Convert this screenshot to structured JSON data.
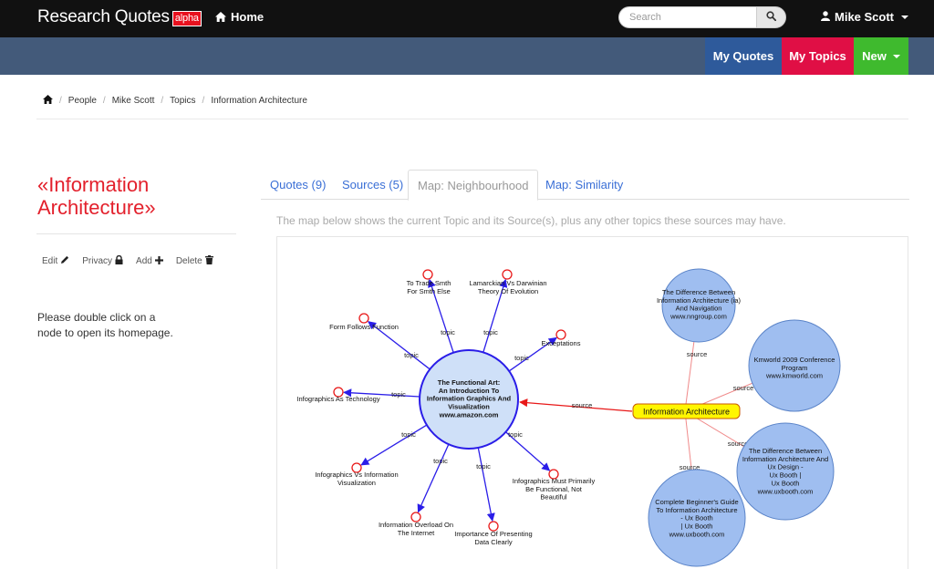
{
  "navbar": {
    "brand": "Research Quotes",
    "brand_badge": "alpha",
    "home_label": "Home",
    "search_placeholder": "Search",
    "user_name": "Mike Scott"
  },
  "subnav": {
    "my_quotes": "My Quotes",
    "my_topics": "My Topics",
    "new_label": "New"
  },
  "colors": {
    "my_quotes": "#2e5a9b",
    "my_topics": "#e00f45",
    "new": "#3fba2e",
    "title_red": "#e3202c",
    "link_blue": "#3a6fd6",
    "node_blue": "#9fbef0"
  },
  "breadcrumb": [
    "People",
    "Mike Scott",
    "Topics",
    "Information Architecture"
  ],
  "topic": {
    "title_line1": "«Information",
    "title_line2": "Architecture»"
  },
  "actions": {
    "edit": "Edit",
    "privacy": "Privacy",
    "add": "Add",
    "delete": "Delete"
  },
  "hint": "Please double click on a node to open its homepage.",
  "tabs": [
    "Quotes (9)",
    "Sources (5)",
    "Map: Neighbourhood",
    "Map: Similarity"
  ],
  "map_description": "The map below shows the current Topic and its Source(s), plus any other topics these sources may have.",
  "map": {
    "center_topic": "Information Architecture",
    "source_book": [
      "The Functional Art:",
      "An Introduction To",
      "Information Graphics And",
      "Visualization",
      "www.amazon.com"
    ],
    "topic_nodes": [
      [
        "To Trade Smth",
        "For Smth Else"
      ],
      [
        "Lamarckian Vs Darwinian",
        "Theory Of Evolution"
      ],
      [
        "Form Follows Function"
      ],
      [
        "Exceptations"
      ],
      [
        "Infographics As Technology"
      ],
      [
        "Infographics Vs Information",
        "Visualization"
      ],
      [
        "Infographics Must Primarily",
        "Be Functional, Not",
        "Beautiful"
      ],
      [
        "Information Overload On",
        "The Internet"
      ],
      [
        "Importance Of Presenting",
        "Data Clearly"
      ]
    ],
    "edge_topic": "topic",
    "edge_source": "source",
    "source_nodes": [
      [
        "The Difference Between",
        "Information Architecture (ia)",
        "And Navigation",
        "www.nngroup.com"
      ],
      [
        "Kmworld 2009 Conference",
        "Program",
        "www.kmworld.com"
      ],
      [
        "The Difference Between",
        "Information Architecture And",
        "Ux Design -",
        "Ux Booth |",
        "Ux Booth",
        "www.uxbooth.com"
      ],
      [
        "Complete Beginner's Guide",
        "To Information Architecture",
        "- Ux Booth",
        "| Ux Booth",
        "www.uxbooth.com"
      ]
    ]
  }
}
